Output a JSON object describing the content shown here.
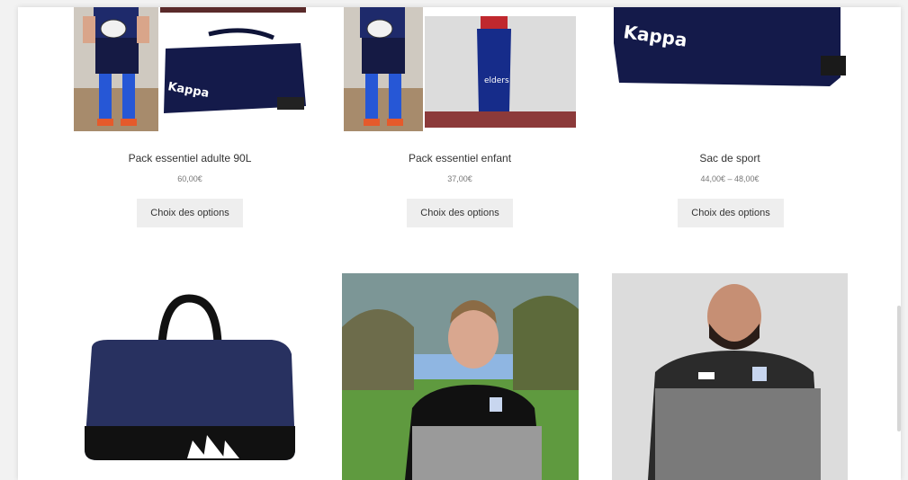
{
  "products": [
    {
      "title": "Pack essentiel adulte 90L",
      "price": "60,00€",
      "button": "Choix des options",
      "image": "rugby-kid-and-kappa-duffel-bag"
    },
    {
      "title": "Pack essentiel enfant",
      "price": "37,00€",
      "button": "Choix des options",
      "image": "rugby-kid-and-water-bottle"
    },
    {
      "title": "Sac de sport",
      "price": "44,00€ – 48,00€",
      "button": "Choix des options",
      "image": "kappa-rolling-sports-bag"
    },
    {
      "image": "kappa-holdall-bag"
    },
    {
      "image": "man-in-black-grey-sweatshirt"
    },
    {
      "image": "man-in-grey-navy-tshirt"
    }
  ],
  "logos": {
    "bag_brand": "Kappa",
    "bottle_brand": "elders"
  },
  "colors": {
    "navy": "#1c1f4a",
    "button_bg": "#eeeeee",
    "text": "#333333"
  }
}
